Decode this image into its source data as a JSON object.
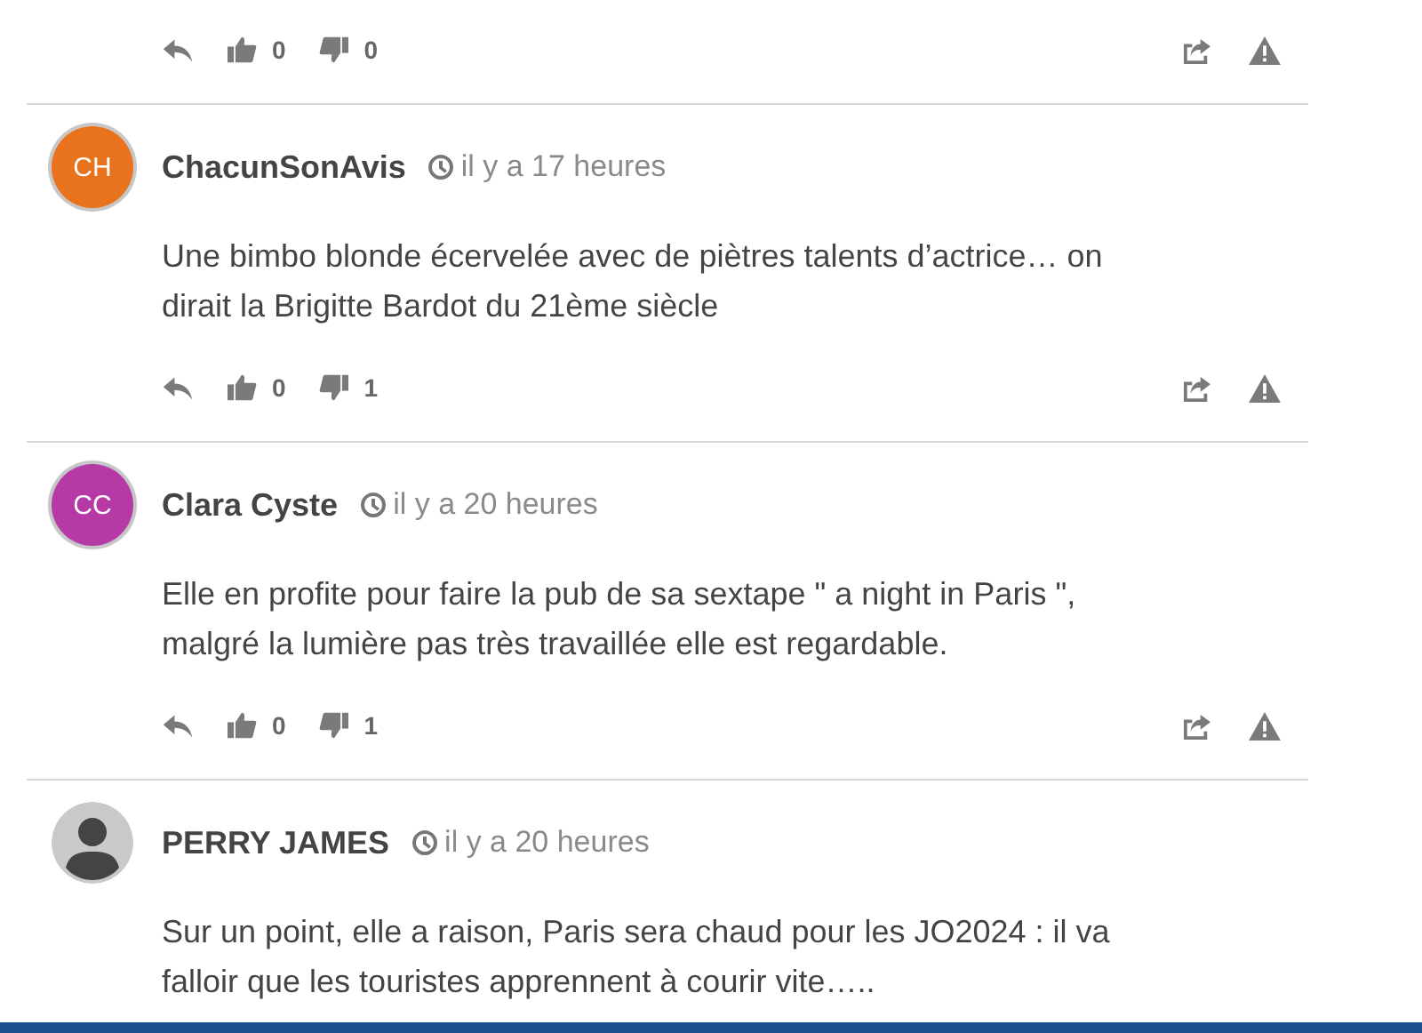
{
  "comments": [
    {
      "actions": {
        "likes": "0",
        "dislikes": "0"
      }
    },
    {
      "avatar": {
        "kind": "initials",
        "initials": "CH",
        "color": "#e8731c"
      },
      "author": "ChacunSonAvis",
      "time": "il y a 17 heures",
      "body": "Une bimbo blonde écervelée avec de piètres talents d’actrice… on\ndirait la Brigitte Bardot du 21ème siècle",
      "actions": {
        "likes": "0",
        "dislikes": "1"
      }
    },
    {
      "avatar": {
        "kind": "initials",
        "initials": "CC",
        "color": "#b53aa6"
      },
      "author": "Clara Cyste",
      "time": "il y a 20 heures",
      "body": "Elle en profite pour faire la pub de sa sextape \" a night in Paris \",\nmalgré la lumière pas très travaillée elle est regardable.",
      "actions": {
        "likes": "0",
        "dislikes": "1"
      }
    },
    {
      "avatar": {
        "kind": "silhouette"
      },
      "author": "PERRY JAMES",
      "time": "il y a 20 heures",
      "body": "Sur un point, elle a raison, Paris sera chaud pour les JO2024 : il va\nfalloir que les touristes apprennent à courir vite….."
    }
  ]
}
